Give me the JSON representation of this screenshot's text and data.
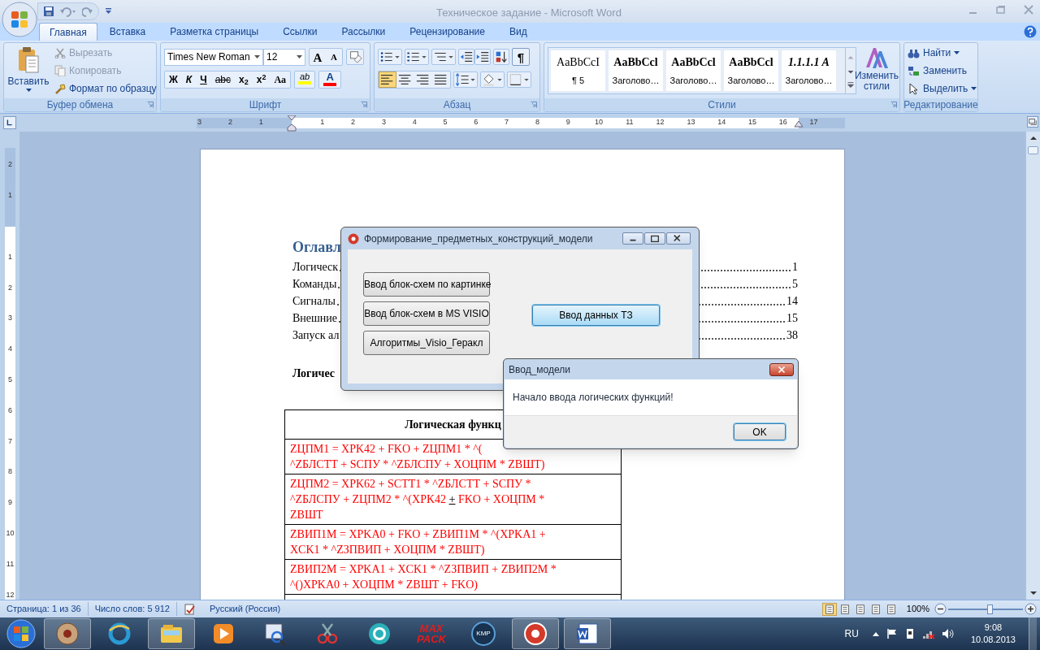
{
  "window": {
    "title": "Техническое задание - Microsoft Word"
  },
  "tabs": [
    {
      "label": "Главная",
      "selected": true
    },
    {
      "label": "Вставка",
      "selected": false
    },
    {
      "label": "Разметка страницы",
      "selected": false
    },
    {
      "label": "Ссылки",
      "selected": false
    },
    {
      "label": "Рассылки",
      "selected": false
    },
    {
      "label": "Рецензирование",
      "selected": false
    },
    {
      "label": "Вид",
      "selected": false
    }
  ],
  "clipboard": {
    "group": "Буфер обмена",
    "paste": "Вставить",
    "items": [
      {
        "label": "Вырезать",
        "disabled": true
      },
      {
        "label": "Копировать",
        "disabled": true
      },
      {
        "label": "Формат по образцу",
        "disabled": false
      }
    ]
  },
  "font": {
    "group": "Шрифт",
    "name": "Times New Roman",
    "size": "12",
    "grow": "A",
    "shrink": "A",
    "format_buttons": [
      "Ж",
      "К",
      "Ч",
      "abc",
      "x$_{2}$",
      "x$^{2}$",
      "Aa"
    ],
    "highlight": "ab",
    "color_button": "A"
  },
  "paragraph": {
    "group": "Абзац",
    "pilcrow": "¶",
    "alignment": [
      {
        "selected": true
      },
      {
        "selected": false
      },
      {
        "selected": false
      },
      {
        "selected": false
      }
    ]
  },
  "styles": {
    "group": "Стили",
    "items": [
      {
        "sample": "AaBbCcI",
        "name": "¶ 5",
        "kind": "normal"
      },
      {
        "sample": "AaBbCcl",
        "name": "Заголово…",
        "kind": "bold"
      },
      {
        "sample": "AaBbCcl",
        "name": "Заголово…",
        "kind": "bold"
      },
      {
        "sample": "AaBbCcl",
        "name": "Заголово…",
        "kind": "bold"
      },
      {
        "sample": "1.1.1.1  A",
        "name": "Заголово…",
        "kind": "bold-italic"
      }
    ],
    "change": "Изменить стили"
  },
  "editing": {
    "group": "Редактирование",
    "items": [
      "Найти",
      "Заменить",
      "Выделить"
    ]
  },
  "ruler": {
    "horizontal": [
      "3",
      "2",
      "1",
      "1",
      "2",
      "3",
      "4",
      "5",
      "6",
      "7",
      "8",
      "9",
      "10",
      "11",
      "12",
      "13",
      "14",
      "15",
      "16",
      "17"
    ],
    "vertical": [
      "2",
      "1",
      "1",
      "2",
      "3",
      "4",
      "5",
      "6",
      "7",
      "8",
      "9",
      "10",
      "11",
      "12"
    ]
  },
  "document": {
    "heading": "Оглавл",
    "toc": [
      {
        "text": "Логическ",
        "page": "1"
      },
      {
        "text": "Команды",
        "page": "5"
      },
      {
        "text": "Сигналы",
        "page": "14"
      },
      {
        "text": "Внешние",
        "page": "15"
      },
      {
        "text": "Запуск ал",
        "page": "38"
      }
    ],
    "section": "Логичес",
    "table": {
      "header": "Логическая функц",
      "rows": [
        [
          [
            {
              "text": "ZЦПМ1 = XPK42 + FKO + ZЦПМ1 * ^(",
              "marked": false
            }
          ],
          [
            {
              "text": "^ZБЛСТТ + SCПУ * ^ZБЛСПУ + XОЦПМ * ZВШТ)",
              "marked": false
            }
          ]
        ],
        [
          [
            {
              "text": "ZЦПМ2 = XPK62 + SCTT1  * ^ZБЛСТТ + SCПУ *",
              "marked": false
            }
          ],
          [
            {
              "text": "^ZБЛСПУ + ZЦПМ2 * ^(XPK42 ",
              "marked": false
            },
            {
              "text": "+",
              "marked": true
            },
            {
              "text": " FKO + XОЦПМ *",
              "marked": false
            }
          ],
          [
            {
              "text": "ZВШТ",
              "marked": false
            }
          ]
        ],
        [
          [
            {
              "text": "ZВИП1М = XPKA0 + FKO + ZВИП1М * ^(XPKA1 +",
              "marked": false
            }
          ],
          [
            {
              "text": "XCK1 * ^ZЗПВИП + XОЦПМ * ZВШТ)",
              "marked": false
            }
          ]
        ],
        [
          [
            {
              "text": "ZВИП2М = XPKA1 + XCK1 * ^ZЗПВИП + ZВИП2М *",
              "marked": false
            }
          ],
          [
            {
              "text": "^()XPKA0 + XОЦПМ * ZВШТ + FKO)",
              "marked": false
            }
          ]
        ]
      ]
    }
  },
  "dialog": {
    "title": "Формирование_предметных_конструкций_модели",
    "buttons": [
      {
        "label": "Ввод блок-схем по картинке",
        "focused": false
      },
      {
        "label": "Ввод блок-схем в MS VISIO",
        "focused": false
      },
      {
        "label": "Алгоритмы_Visio_Геракл",
        "focused": false
      },
      {
        "label": "Ввод данных ТЗ",
        "focused": true
      }
    ]
  },
  "message_box": {
    "title": "Ввод_модели",
    "message": "Начало ввода логических функций!",
    "button": "OK"
  },
  "status_bar": {
    "page": "Страница: 1 из 36",
    "words": "Число слов: 5 912",
    "language": "Русский (Россия)",
    "zoom": "100%",
    "zoom_level": {
      "level": 0.55
    }
  },
  "taskbar": {
    "max_pack": [
      "MAX",
      "PACK"
    ],
    "kmp": "KMP",
    "language": "RU",
    "time": "9:08",
    "date": "10.08.2013"
  }
}
